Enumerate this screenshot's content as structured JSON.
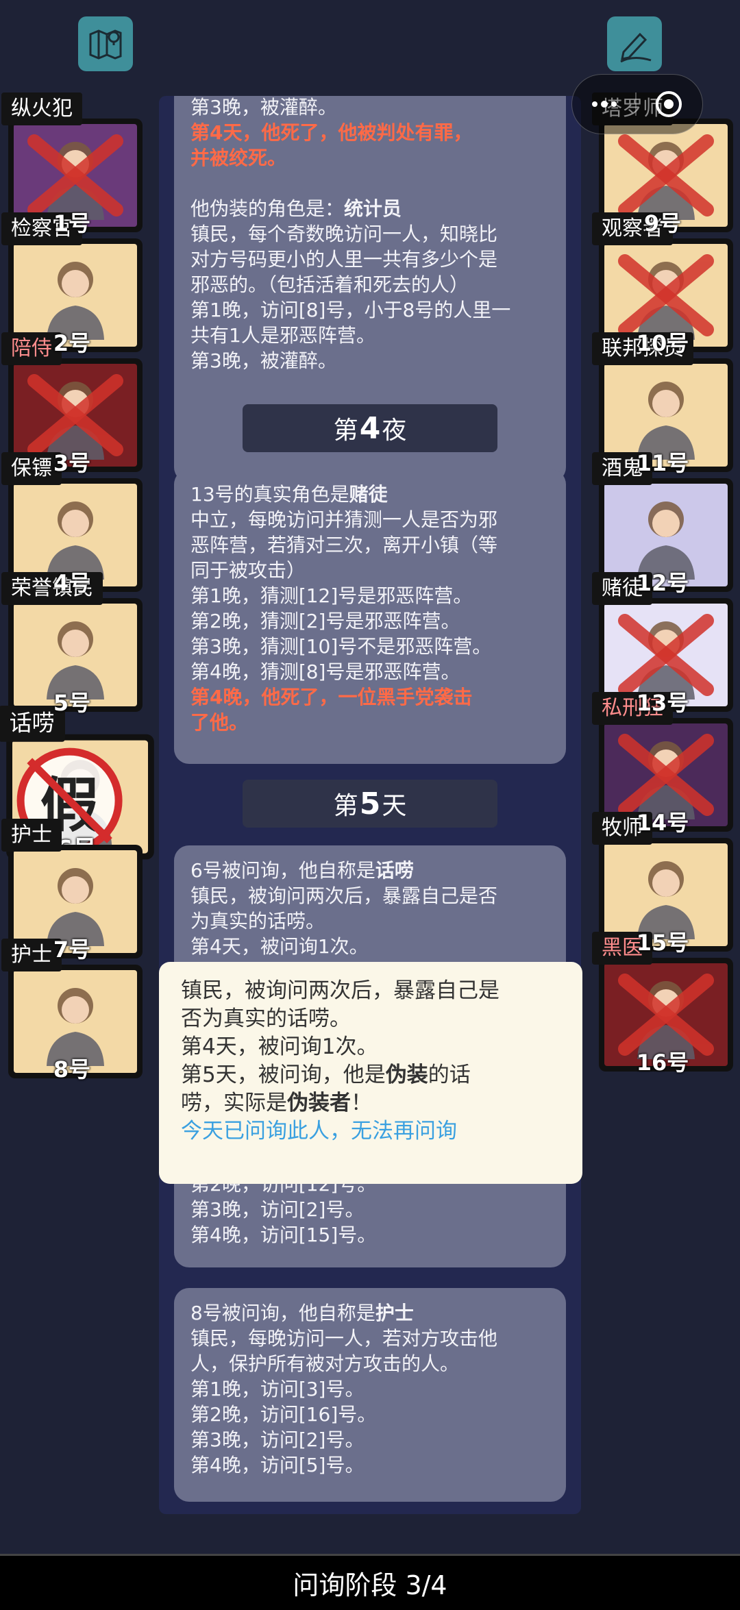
{
  "topbar": {
    "left_icon": "map-pin-icon",
    "right_icon": "pencil-icon"
  },
  "capsule": {
    "left_icon": "more-dots-icon",
    "right_icon": "target-icon"
  },
  "left_players": [
    {
      "role": "纵火犯",
      "num": "1号",
      "dead": true,
      "pink": false,
      "bg": "#6a3a7a"
    },
    {
      "role": "检察官",
      "num": "2号",
      "dead": false,
      "pink": false,
      "bg": "#f3d9a6"
    },
    {
      "role": "陪侍",
      "num": "3号",
      "dead": true,
      "pink": true,
      "bg": "#7a1f23"
    },
    {
      "role": "保镖",
      "num": "4号",
      "dead": false,
      "pink": false,
      "bg": "#f3d9a6"
    },
    {
      "role": "荣誉镇民",
      "num": "5号",
      "dead": false,
      "pink": false,
      "bg": "#f3d9a6"
    },
    {
      "role": "话唠",
      "num": "6号",
      "dead": false,
      "pink": false,
      "bg": "#f3d9a6"
    },
    {
      "role": "护士",
      "num": "7号",
      "dead": false,
      "pink": false,
      "bg": "#f3d9a6"
    },
    {
      "role": "护士",
      "num": "8号",
      "dead": false,
      "pink": false,
      "bg": "#f3d9a6"
    }
  ],
  "right_players": [
    {
      "role": "塔罗师",
      "num": "9号",
      "dead": true,
      "pink": false,
      "bg": "#f3d9a6"
    },
    {
      "role": "观察者",
      "num": "10号",
      "dead": true,
      "pink": false,
      "bg": "#f3d9a6"
    },
    {
      "role": "联邦探员",
      "num": "11号",
      "dead": false,
      "pink": false,
      "bg": "#f3d9a6"
    },
    {
      "role": "酒鬼",
      "num": "12号",
      "dead": false,
      "pink": false,
      "bg": "#ccc8ea"
    },
    {
      "role": "赌徒",
      "num": "13号",
      "dead": true,
      "pink": false,
      "bg": "#e6e2f6"
    },
    {
      "role": "私刑狂",
      "num": "14号",
      "dead": true,
      "pink": true,
      "bg": "#4c2a5a"
    },
    {
      "role": "牧师",
      "num": "15号",
      "dead": false,
      "pink": false,
      "bg": "#f3d9a6"
    },
    {
      "role": "黑医",
      "num": "16号",
      "dead": true,
      "pink": true,
      "bg": "#7a1f23"
    }
  ],
  "fake_stamp": "假",
  "card1": {
    "l1": "第3晚，被灌醉。",
    "l2": "第4天，他死了，他被判处有罪，",
    "l3": "并被绞死。",
    "l4_pre": "他伪装的角色是：",
    "l4_role": "统计员",
    "l5": "镇民，每个奇数晚访问一人，知晓比",
    "l6": "对方号码更小的人里一共有多少个是",
    "l7": "邪恶的。（包括活着和死去的人）",
    "l8": "第1晚，访问[8]号，小于8号的人里一",
    "l9": "共有1人是邪恶阵营。",
    "l10": "第3晚，被灌醉。"
  },
  "sep1": {
    "pre": "第",
    "num": "4",
    "post": "夜"
  },
  "card2": {
    "l1_pre": "13号的真实角色是",
    "l1_role": "赌徒",
    "l2": "中立，每晚访问并猜测一人是否为邪",
    "l3": "恶阵营，若猜对三次，离开小镇（等",
    "l4": "同于被攻击）",
    "l5": "第1晚，猜测[12]号是邪恶阵营。",
    "l6": "第2晚，猜测[2]号是邪恶阵营。",
    "l7": "第3晚，猜测[10]号不是邪恶阵营。",
    "l8": "第4晚，猜测[8]号是邪恶阵营。",
    "l9": "第4晚，他死了，一位黑手党袭击",
    "l10": "了他。"
  },
  "sep2": {
    "pre": "第",
    "num": "5",
    "post": "天"
  },
  "card3": {
    "l1_pre": "6号被问询，他自称是",
    "l1_role": "话唠",
    "l2": "镇民，被询问两次后，暴露自己是否",
    "l3": "为真实的话唠。",
    "l4": "第4天，被问询1次。"
  },
  "card4": {
    "l1": "第2晚，访问[12]号。",
    "l2": "第3晚，访问[2]号。",
    "l3": "第4晚，访问[15]号。"
  },
  "card5": {
    "l1_pre": "8号被问询，他自称是",
    "l1_role": "护士",
    "l2": "镇民，每晚访问一人，若对方攻击他",
    "l3": "人，保护所有被对方攻击的人。",
    "l4": "第1晚，访问[3]号。",
    "l5": "第2晚，访问[16]号。",
    "l6": "第3晚，访问[2]号。",
    "l7": "第4晚，访问[5]号。"
  },
  "popup": {
    "l1": "镇民，被询问两次后，暴露自己是",
    "l2": "否为真实的话唠。",
    "l3": "第4天，被问询1次。",
    "l4_pre": "第5天，被问询，他是",
    "l4_b": "伪装",
    "l4_post": "的话",
    "l5_pre": "唠，实际是",
    "l5_b": "伪装者",
    "l5_post": "！",
    "l6": "今天已问询此人，无法再问询"
  },
  "bottom": "问询阶段 3/4"
}
